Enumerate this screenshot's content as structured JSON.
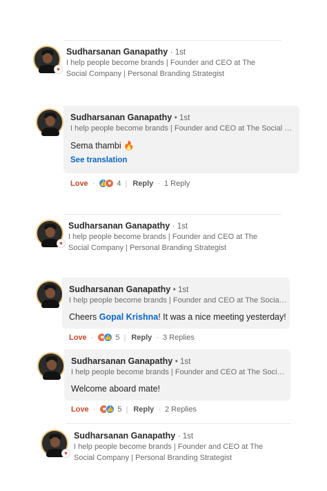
{
  "author": {
    "name": "Sudharsanan Ganapathy",
    "degree": "1st",
    "headline_full": "I help people become brands | Founder and CEO at The Social Company | Personal Branding Strategist",
    "headline_short": "I help people become brands | Founder and CEO at The Social Co..."
  },
  "icons": {
    "badge": "love-heart-icon",
    "like": "like-reaction-icon",
    "heart": "love-reaction-icon",
    "emoji": "fire-emoji-icon"
  },
  "colors": {
    "love": "#c6472a",
    "link": "#0a66c2",
    "bubble": "#f2f2f2"
  },
  "comment1": {
    "text": "Sema thambi",
    "emoji": "🔥",
    "see_translation": "See translation",
    "love": "Love",
    "count": "4",
    "reply": "Reply",
    "replies": "1 Reply"
  },
  "comment2": {
    "text_before": "Cheers ",
    "mention": "Gopal Krishna",
    "text_after": "! It was a nice meeting yesterday!",
    "love": "Love",
    "count": "5",
    "reply": "Reply",
    "replies": "3 Replies"
  },
  "comment3": {
    "text": "Welcome aboard mate!",
    "love": "Love",
    "count": "5",
    "reply": "Reply",
    "replies": "2 Replies"
  }
}
